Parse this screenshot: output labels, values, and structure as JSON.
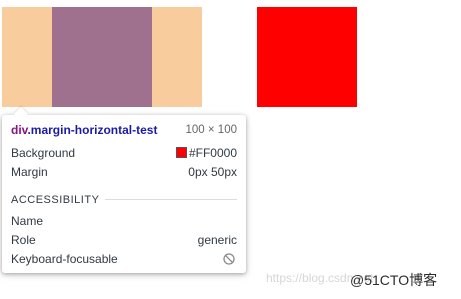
{
  "overlay": {
    "margin_color": "#f9cc9d",
    "content_color": "#a0708f",
    "sibling_color": "#ff0000"
  },
  "tooltip": {
    "selector_tag": "div",
    "selector_class": ".margin-horizontal-test",
    "dimensions": "100 × 100",
    "background_label": "Background",
    "background_value": "#FF0000",
    "background_swatch": "#ff0000",
    "margin_label": "Margin",
    "margin_value": "0px 50px",
    "accessibility_heading": "ACCESSIBILITY",
    "name_label": "Name",
    "role_label": "Role",
    "role_value": "generic",
    "keyboard_label": "Keyboard-focusable",
    "keyboard_icon": "not-focusable-icon"
  },
  "watermark": {
    "url_text": "https://blog.csdn.net",
    "brand_text": "@51CTO博客"
  }
}
